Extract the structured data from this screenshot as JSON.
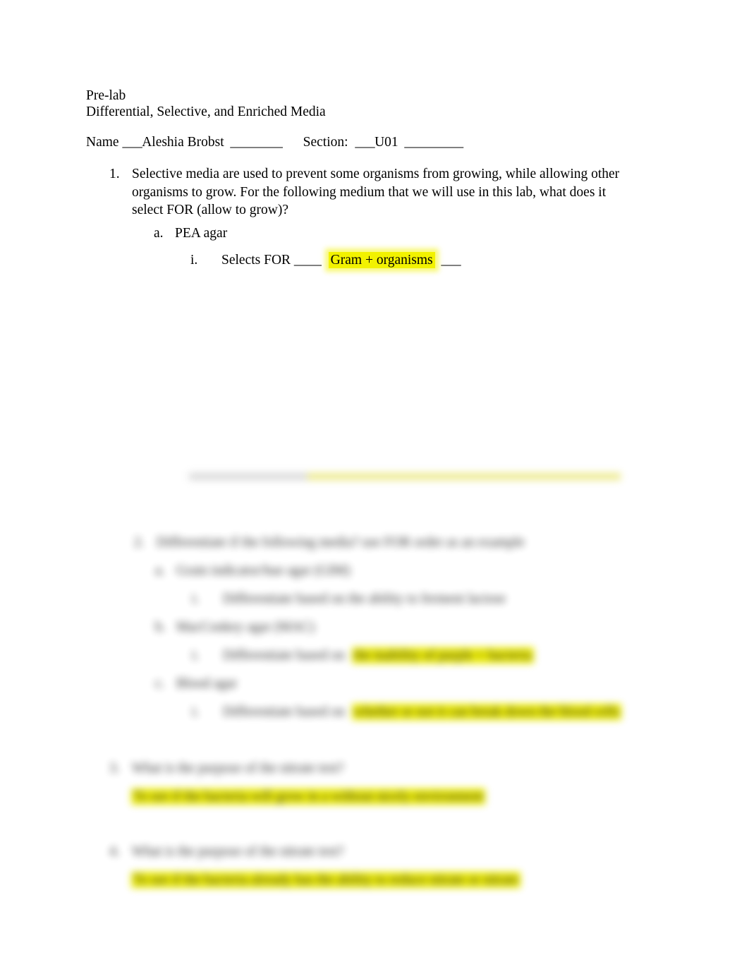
{
  "document": {
    "title_line_1": "Pre-lab",
    "title_line_2": "Differential, Selective, and Enriched Media"
  },
  "name_section": {
    "name_label": "Name ",
    "name_rule_before": "___",
    "name_value": "Aleshia Brobst",
    "name_rule_after": "  ________",
    "gap": "      ",
    "section_label": "Section:  ",
    "section_rule_before": "___",
    "section_value": "U01",
    "section_rule_after": "  _________"
  },
  "question_1": {
    "number": "1.",
    "text": "Selective media are used to prevent some organisms from growing, while allowing other organisms to grow. For the following medium that we will use in this lab, what does it select FOR (allow to grow)?",
    "item_a": {
      "marker": "a.",
      "label": "PEA agar",
      "sub_i": {
        "marker": "i.",
        "prompt": "Selects FOR ____",
        "answer": "Gram + organisms",
        "trailing_rule": "  ___"
      }
    }
  },
  "redacted_block": {
    "note": "blurred / illegible content",
    "question_2": {
      "number": "2.",
      "text": "Differentiate if the following media? use FOR order as an example",
      "item_a": {
        "marker": "a.",
        "label": "Grain indicator/hue agar (GIM)",
        "sub_i": {
          "marker": "i.",
          "prompt": "Differentiate based on",
          "answer": "the ability to ferment lactose"
        }
      },
      "item_b": {
        "marker": "b.",
        "label": "MacConkey agar (MAC)",
        "sub_i": {
          "marker": "i.",
          "prompt": "Differentiate based on",
          "answer": "the inability of purple + bacteria"
        }
      },
      "item_c": {
        "marker": "c.",
        "label": "Blood agar",
        "sub_i": {
          "marker": "i.",
          "prompt": "Differentiate based on",
          "answer": "whether or not it can break down the blood cells"
        }
      }
    },
    "question_3": {
      "number": "3.",
      "text": "What is the purpose of the nitrate test?",
      "answer": "To see if the bacteria will grow in a without nicely environment"
    },
    "question_4": {
      "number": "4.",
      "text": "What is the purpose of the nitrate test?",
      "answer": "To see if the bacteria already has the ability to reduce nitrate or nitrate"
    }
  }
}
